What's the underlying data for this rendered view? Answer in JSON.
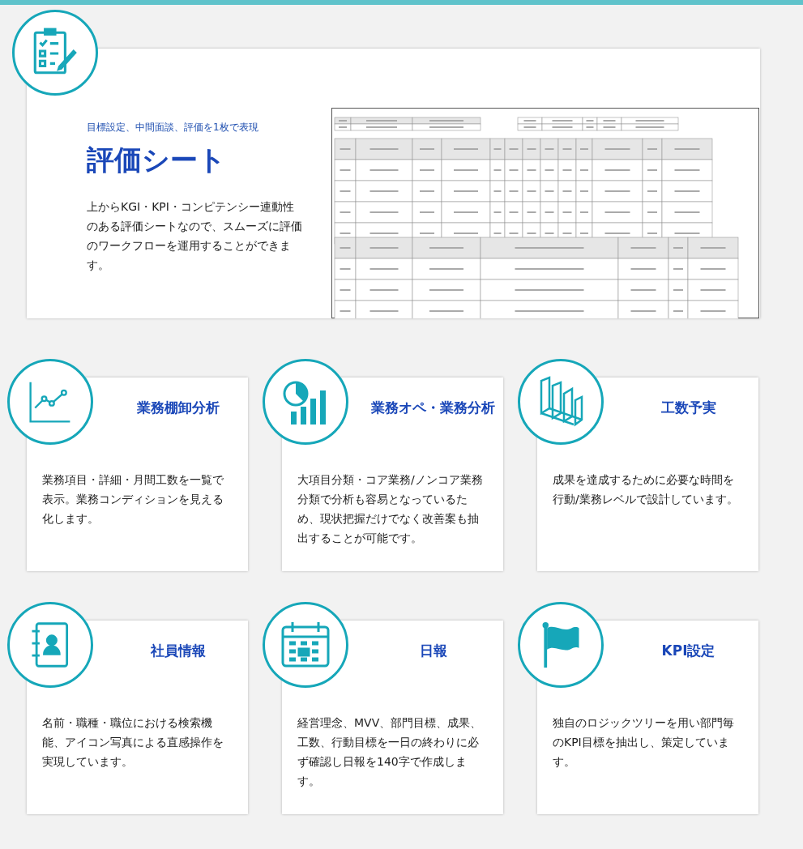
{
  "sheet_section": {
    "subtitle": "目標設定、中間面談、評価を1枚で表現",
    "title": "評価シート",
    "description": "上からKGI・KPI・コンピテンシー連動性のある評価シートなので、スムーズに評価のワークフローを運用することができます。"
  },
  "features": [
    {
      "title": "業務棚卸分析",
      "description": "業務項目・詳細・月間工数を一覧で表示。業務コンディションを見える化します。"
    },
    {
      "title": "業務オペ・業務分析",
      "description": "大項目分類・コア業務/ノンコア業務分類で分析も容易となっているため、現状把握だけでなく改善案も抽出することが可能です。"
    },
    {
      "title": "工数予実",
      "description": "成果を達成するために必要な時間を行動/業務レベルで設計しています。"
    },
    {
      "title": "社員情報",
      "description": "名前・職種・職位における検索機能、アイコン写真による直感操作を実現しています。"
    },
    {
      "title": "日報",
      "description": "経営理念、MVV、部門目標、成果、工数、行動目標を一日の終わりに必ず確認し日報を140字で作成します。"
    },
    {
      "title": "KPI設定",
      "description": "独自のロジックツリーを用い部門毎のKPI目標を抽出し、策定しています。"
    }
  ]
}
